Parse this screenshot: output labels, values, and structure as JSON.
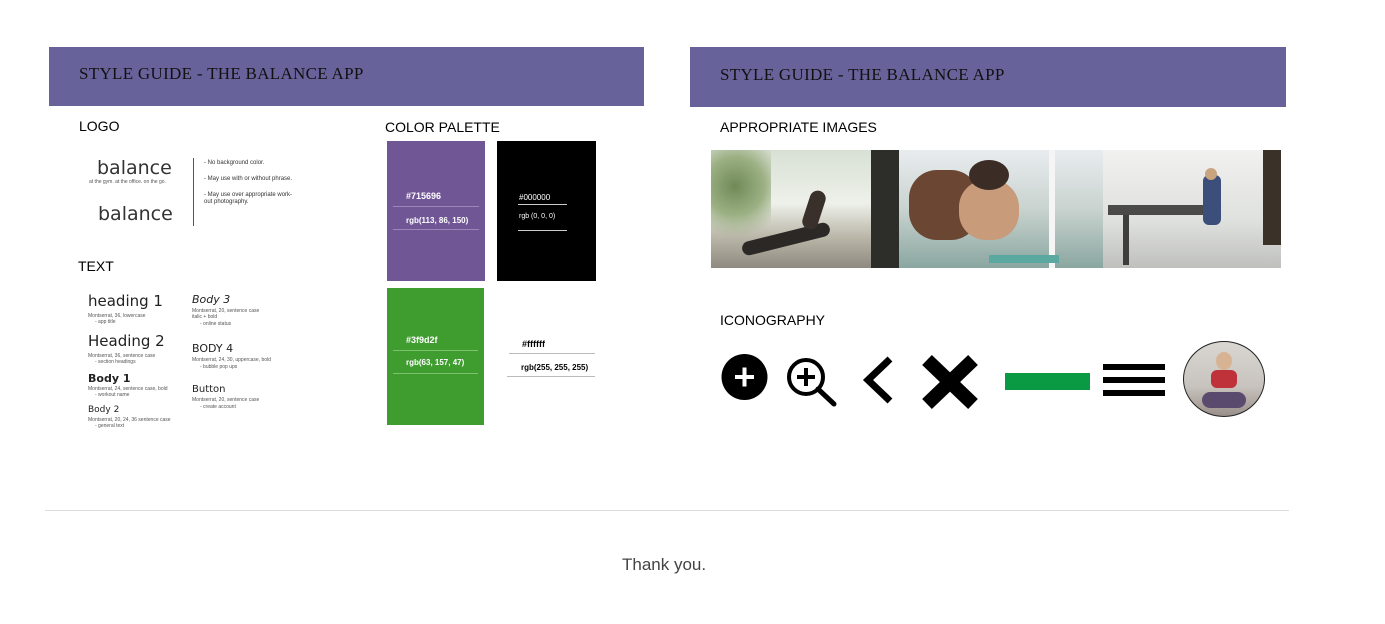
{
  "left_card": {
    "title": "STYLE GUIDE - THE BALANCE APP",
    "logo_heading": "LOGO",
    "logo_word": "balance",
    "logo_tagline": "at the gym. at the office. on the go.",
    "logo_word_plain": "balance",
    "logo_notes": [
      "- No background color.",
      "- May use with or without phrase.",
      "- May use over appropriate work-",
      "out photography."
    ],
    "text_heading": "TEXT",
    "text_styles_left": [
      {
        "title": "heading 1",
        "desc1": "Montserrat, 36, lowercase",
        "desc2": "-      app title"
      },
      {
        "title": "Heading 2",
        "desc1": "Montserrat, 36, sentence case",
        "desc2": "-      section headings"
      },
      {
        "title": "Body 1",
        "desc1": "Montserrat, 24, sentence case, bold",
        "desc2": "-      workout name"
      },
      {
        "title": "Body 2",
        "desc1": "Montserrat, 20, 24, 36 sentence case",
        "desc2": "-      general text"
      }
    ],
    "text_styles_right": [
      {
        "title": "Body 3",
        "desc1": "Montserrat, 20, sentence case",
        "desc2": "italic + bold",
        "desc3": "-      online status"
      },
      {
        "title": "BODY 4",
        "desc1": "Montserrat, 24, 30, uppercase, bold",
        "desc2": "-      bubble pop ups"
      },
      {
        "title": "Button",
        "desc1": "Montserrat, 20, sentence case",
        "desc2": "-      create account"
      }
    ],
    "palette_heading": "COLOR PALETTE",
    "palette": [
      {
        "hex": "#715696",
        "rgb": "rgb(113, 86, 150)",
        "color": "#715696",
        "text_color": "#ffffff"
      },
      {
        "hex": "#000000",
        "rgb": "rgb (0, 0, 0)",
        "color": "#000000",
        "text_color": "#ffffff"
      },
      {
        "hex": "#3f9d2f",
        "rgb": "rgb(63, 157, 47)",
        "color": "#3f9d2f",
        "text_color": "#ffffff"
      },
      {
        "hex": "#ffffff",
        "rgb": "rgb(255, 255, 255)",
        "color": "#ffffff",
        "text_color": "#000000"
      }
    ]
  },
  "right_card": {
    "title": "STYLE GUIDE - THE BALANCE APP",
    "images_heading": "APPROPRIATE IMAGES",
    "iconography_heading": "ICONOGRAPHY",
    "icons": [
      "plus-circle-icon",
      "zoom-in-icon",
      "chevron-left-icon",
      "close-x-icon",
      "minus-bar-icon",
      "hamburger-menu-icon",
      "avatar-photo"
    ],
    "minus_color": "#0a9a44"
  },
  "footer": {
    "thanks": "Thank you."
  },
  "colors": {
    "header_band": "#67639a",
    "divider": "#dddddd"
  }
}
